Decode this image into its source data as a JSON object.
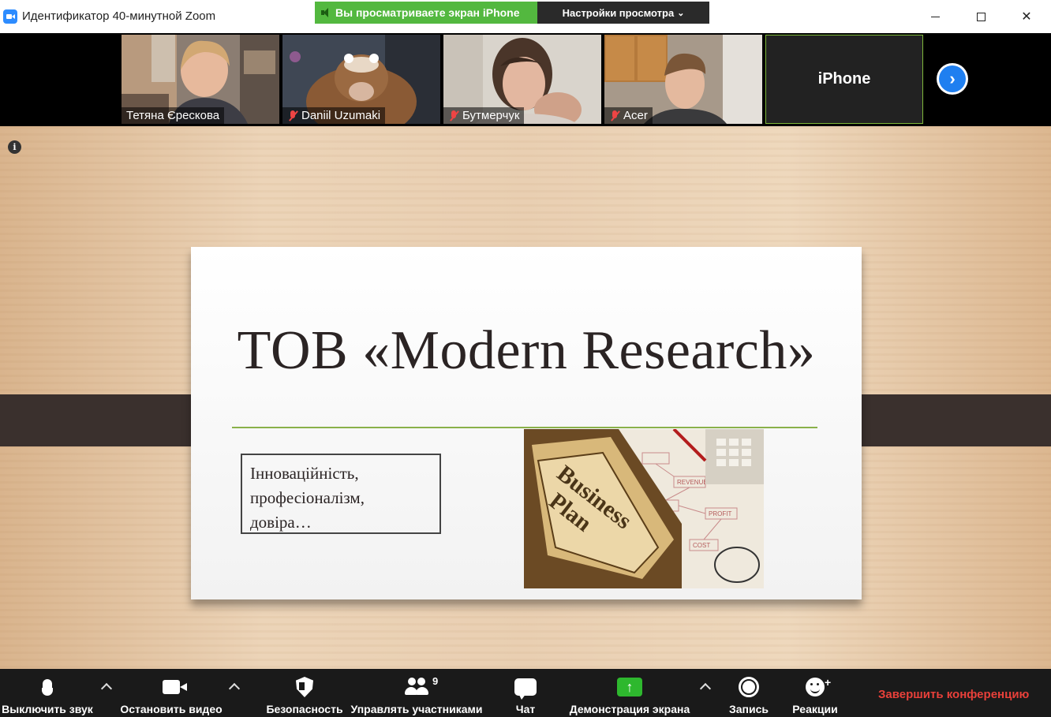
{
  "window": {
    "title": "Идентификатор 40-минутной Zoom"
  },
  "banner": {
    "viewing_text": "Вы просматриваете экран iPhone",
    "view_options": "Настройки просмотра"
  },
  "gallery": {
    "tiles": [
      {
        "name": "Тетяна Єрескова",
        "muted": false
      },
      {
        "name": "Daniil Uzumaki",
        "muted": true
      },
      {
        "name": "Бутмерчук",
        "muted": true
      },
      {
        "name": "Acer",
        "muted": true
      },
      {
        "name": "iPhone",
        "muted": false
      }
    ]
  },
  "slide": {
    "title": "ТОВ «Modern Research»",
    "box_lines": [
      "Інноваційність,",
      "професіоналізм,",
      "довіра…"
    ],
    "image_text": [
      "Business",
      "Plan"
    ],
    "chart_words": [
      "PROFIT",
      "REVENUE",
      "COST"
    ]
  },
  "toolbar": {
    "mute": "Выключить звук",
    "video": "Остановить видео",
    "security": "Безопасность",
    "participants": "Управлять участниками",
    "participants_count": "9",
    "chat": "Чат",
    "share": "Демонстрация экрана",
    "record": "Запись",
    "reactions": "Реакции",
    "end": "Завершить конференцию"
  },
  "colors": {
    "banner_green": "#53b83f",
    "end_red": "#e8403a",
    "share_green": "#2eb82e",
    "next_blue": "#1f7ff0",
    "slide_rule": "#8ab14a"
  }
}
